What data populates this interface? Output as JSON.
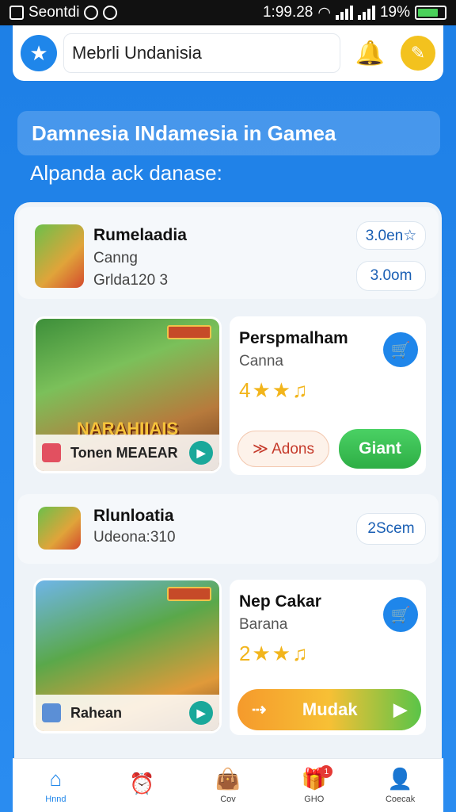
{
  "status_bar": {
    "carrier": "Seontdi",
    "time": "1:99.28",
    "battery_text": "19%",
    "battery_level": 0.78
  },
  "header": {
    "search_value": "Mebrli Undanisia",
    "logo_icon": "star-logo-icon",
    "bell_icon": "bell-icon",
    "profile_icon": "profile-icon"
  },
  "hero": {
    "title": "Damnesia INdamesia in Gamea",
    "subtitle": "Alpanda ack danase:"
  },
  "games": [
    {
      "title": "Rumelaadia",
      "subtitle": "Canng",
      "meta": "Grldа120 3",
      "pill_1": "3.0en☆",
      "pill_2": "3.0om",
      "card_overlay_title": "NARAHIIAIS",
      "card_bottom_label": "Tonen MEAEAR",
      "info_title": "Perspmalham",
      "info_sub": "Canna",
      "rating_value": 4,
      "rating_glyphs": "4★★♫",
      "add_label": "≫ Adons",
      "get_label": "Giant"
    },
    {
      "title": "Rlunloatia",
      "subtitle": "Udeona:310",
      "pill_1": "2Scem",
      "card_bottom_label": "Rahean",
      "info_title": "Nep Cakar",
      "info_sub": "Barana",
      "rating_value": 2,
      "rating_glyphs": "2★★♫",
      "mudak_label": "Mudak"
    }
  ],
  "bottom_nav": [
    {
      "label": "Hnnd",
      "icon": "home-icon",
      "active": true
    },
    {
      "label": "",
      "icon": "alarm-icon",
      "active": false
    },
    {
      "label": "Cov",
      "icon": "bag-icon",
      "active": false
    },
    {
      "label": "GHO",
      "icon": "gift-icon",
      "active": false,
      "badge": "1"
    },
    {
      "label": "Coecak",
      "icon": "user-icon",
      "active": false
    }
  ],
  "colors": {
    "accent": "#1f86ea",
    "background": "#2a8cf0",
    "get_button": "#3cc456",
    "star": "#f2b51c"
  }
}
